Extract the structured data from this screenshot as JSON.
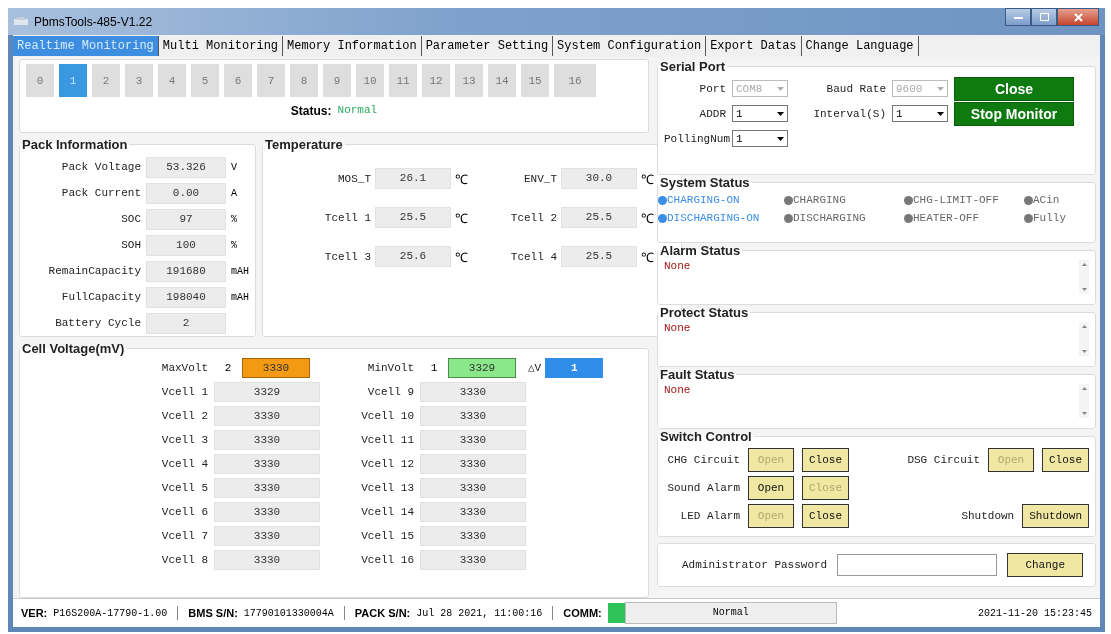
{
  "window": {
    "title": "PbmsTools-485-V1.22"
  },
  "tabs": [
    {
      "label": "Realtime Monitoring",
      "selected": true
    },
    {
      "label": "Multi Monitoring",
      "selected": false
    },
    {
      "label": "Memory Information",
      "selected": false
    },
    {
      "label": "Parameter Setting",
      "selected": false
    },
    {
      "label": "System Configuration",
      "selected": false
    },
    {
      "label": "Export Datas",
      "selected": false
    },
    {
      "label": "Change Language",
      "selected": false
    }
  ],
  "pack_buttons": [
    {
      "label": "0",
      "selected": false
    },
    {
      "label": "1",
      "selected": true
    },
    {
      "label": "2",
      "selected": false
    },
    {
      "label": "3",
      "selected": false
    },
    {
      "label": "4",
      "selected": false
    },
    {
      "label": "5",
      "selected": false
    },
    {
      "label": "6",
      "selected": false
    },
    {
      "label": "7",
      "selected": false
    },
    {
      "label": "8",
      "selected": false
    },
    {
      "label": "9",
      "selected": false
    },
    {
      "label": "10",
      "selected": false
    },
    {
      "label": "11",
      "selected": false
    },
    {
      "label": "12",
      "selected": false
    },
    {
      "label": "13",
      "selected": false
    },
    {
      "label": "14",
      "selected": false
    },
    {
      "label": "15",
      "selected": false
    },
    {
      "label": "16",
      "selected": false
    }
  ],
  "status": {
    "label": "Status:",
    "value": "Normal"
  },
  "pack_information": {
    "title": "Pack Information",
    "rows": [
      {
        "label": "Pack Voltage",
        "value": "53.326",
        "unit": "V"
      },
      {
        "label": "Pack Current",
        "value": "0.00",
        "unit": "A"
      },
      {
        "label": "SOC",
        "value": "97",
        "unit": "%"
      },
      {
        "label": "SOH",
        "value": "100",
        "unit": "%"
      },
      {
        "label": "RemainCapacity",
        "value": "191680",
        "unit": "mAH"
      },
      {
        "label": "FullCapacity",
        "value": "198040",
        "unit": "mAH"
      },
      {
        "label": "Battery Cycle",
        "value": "2"
      }
    ]
  },
  "temperature": {
    "title": "Temperature",
    "items": [
      {
        "label": "MOS_T",
        "value": "26.1",
        "unit": "℃"
      },
      {
        "label": "ENV_T",
        "value": "30.0",
        "unit": "℃"
      },
      {
        "label": "Tcell 1",
        "value": "25.5",
        "unit": "℃"
      },
      {
        "label": "Tcell 2",
        "value": "25.5",
        "unit": "℃"
      },
      {
        "label": "Tcell 3",
        "value": "25.6",
        "unit": "℃"
      },
      {
        "label": "Tcell 4",
        "value": "25.5",
        "unit": "℃"
      }
    ]
  },
  "cell_voltage": {
    "title": "Cell Voltage(mV)",
    "max": {
      "label": "MaxVolt",
      "index": "2",
      "value": "3330"
    },
    "min": {
      "label": "MinVolt",
      "index": "1",
      "value": "3329"
    },
    "delta": {
      "label": "△V",
      "value": "1"
    },
    "cells": [
      {
        "label": "Vcell 1",
        "value": "3329"
      },
      {
        "label": "Vcell 2",
        "value": "3330"
      },
      {
        "label": "Vcell 3",
        "value": "3330"
      },
      {
        "label": "Vcell 4",
        "value": "3330"
      },
      {
        "label": "Vcell 5",
        "value": "3330"
      },
      {
        "label": "Vcell 6",
        "value": "3330"
      },
      {
        "label": "Vcell 7",
        "value": "3330"
      },
      {
        "label": "Vcell 8",
        "value": "3330"
      },
      {
        "label": "Vcell 9",
        "value": "3330"
      },
      {
        "label": "Vcell 10",
        "value": "3330"
      },
      {
        "label": "Vcell 11",
        "value": "3330"
      },
      {
        "label": "Vcell 12",
        "value": "3330"
      },
      {
        "label": "Vcell 13",
        "value": "3330"
      },
      {
        "label": "Vcell 14",
        "value": "3330"
      },
      {
        "label": "Vcell 15",
        "value": "3330"
      },
      {
        "label": "Vcell 16",
        "value": "3330"
      }
    ]
  },
  "serial_port": {
    "title": "Serial Port",
    "fields": [
      {
        "label": "Port",
        "value": "COM8",
        "disabled": true
      },
      {
        "label": "Baud Rate",
        "value": "9600",
        "disabled": true
      },
      {
        "label": "ADDR",
        "value": "1",
        "disabled": false
      },
      {
        "label": "Interval(S)",
        "value": "1",
        "disabled": false
      },
      {
        "label": "PollingNum",
        "value": "1",
        "disabled": false
      }
    ],
    "buttons": [
      "Close",
      "Stop Monitor"
    ]
  },
  "system_status": {
    "title": "System Status",
    "items": [
      {
        "label": "CHARGING-ON",
        "on": true
      },
      {
        "label": "CHARGING",
        "on": false
      },
      {
        "label": "CHG-LIMIT-OFF",
        "on": false
      },
      {
        "label": "ACin",
        "on": false
      },
      {
        "label": "DISCHARGING-ON",
        "on": true
      },
      {
        "label": "DISCHARGING",
        "on": false
      },
      {
        "label": "HEATER-OFF",
        "on": false
      },
      {
        "label": "Fully",
        "on": false
      }
    ]
  },
  "status_boxes": [
    {
      "title": "Alarm Status",
      "text": "None"
    },
    {
      "title": "Protect Status",
      "text": "None"
    },
    {
      "title": "Fault Status",
      "text": "None"
    }
  ],
  "switch_control": {
    "title": "Switch Control",
    "rows": [
      {
        "cells": [
          {
            "label": "CHG Circuit",
            "buttons": [
              {
                "label": "Open",
                "disabled": true
              },
              {
                "label": "Close",
                "disabled": false
              }
            ]
          },
          {
            "label": "DSG Circuit",
            "buttons": [
              {
                "label": "Open",
                "disabled": true
              },
              {
                "label": "Close",
                "disabled": false
              }
            ]
          }
        ]
      },
      {
        "cells": [
          {
            "label": "Sound Alarm",
            "buttons": [
              {
                "label": "Open",
                "disabled": false
              },
              {
                "label": "Close",
                "disabled": true
              }
            ]
          }
        ]
      },
      {
        "cells": [
          {
            "label": "LED Alarm",
            "buttons": [
              {
                "label": "Open",
                "disabled": true
              },
              {
                "label": "Close",
                "disabled": false
              }
            ]
          },
          {
            "label": "Shutdown",
            "buttons": [
              {
                "label": "Shutdown",
                "disabled": false
              }
            ]
          }
        ]
      }
    ]
  },
  "password": {
    "label": "Administrator Password",
    "button": "Change"
  },
  "status_bar": {
    "ver_label": "VER:",
    "ver": "P16S200A-17790-1.00",
    "bms_label": "BMS S/N:",
    "bms": "17790101330004A",
    "pack_label": "PACK S/N:",
    "pack": "Jul 28 2021, 11:00:16",
    "comm_label": "COMM:",
    "comm": "Normal",
    "time": "2021-11-20 15:23:45"
  }
}
